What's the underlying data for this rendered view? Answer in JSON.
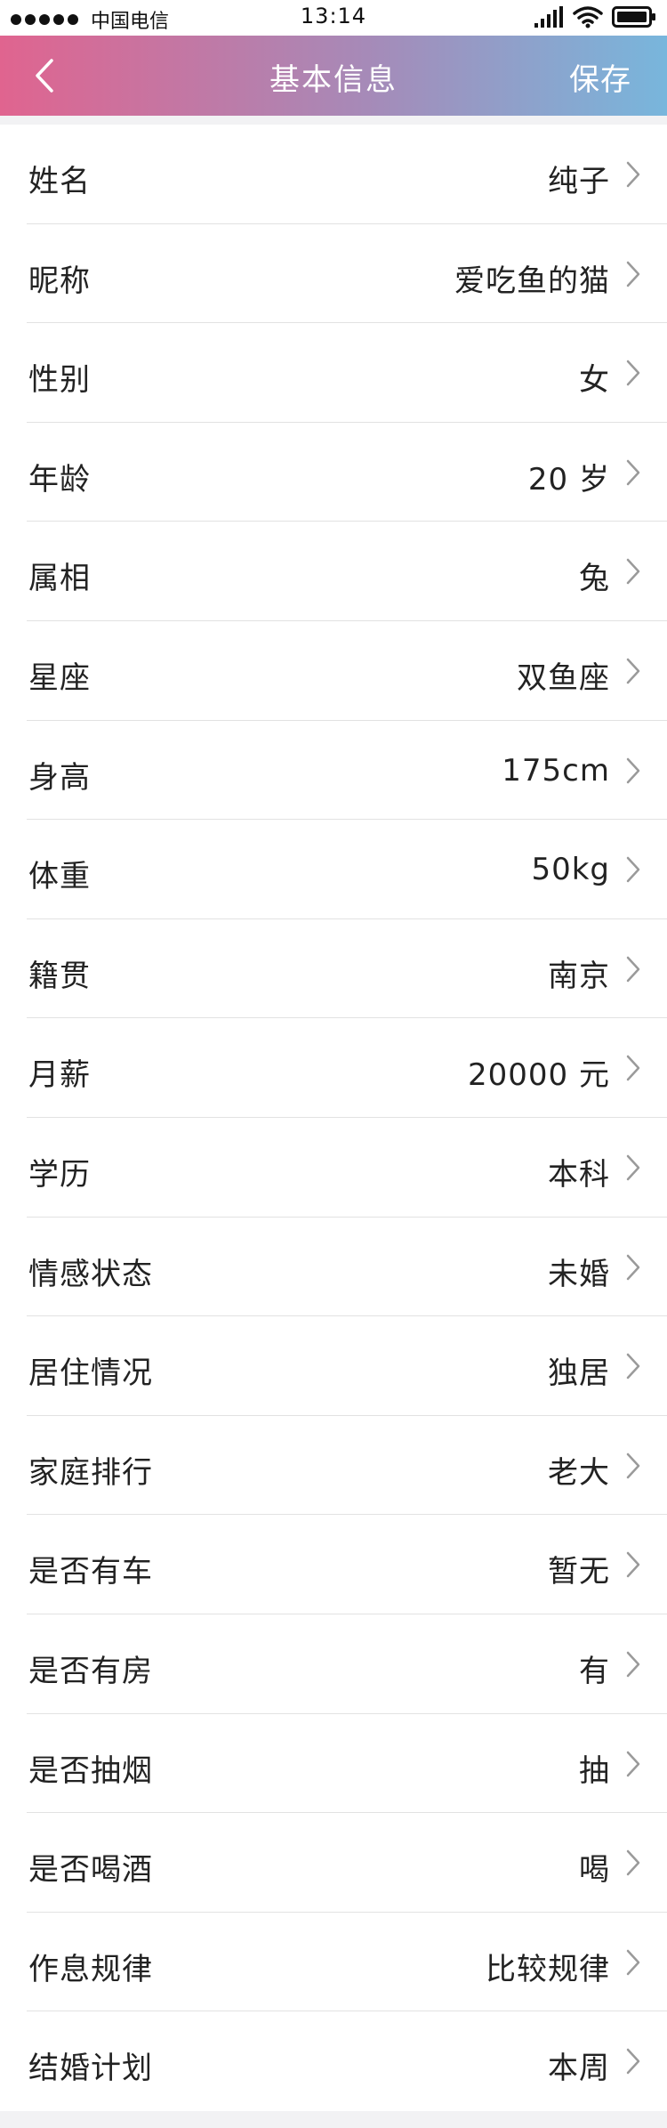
{
  "status_bar": {
    "carrier": "中国电信",
    "time": "13:14"
  },
  "nav": {
    "title": "基本信息",
    "save_label": "保存"
  },
  "fields": [
    {
      "label": "姓名",
      "value": "纯子"
    },
    {
      "label": "昵称",
      "value": "爱吃鱼的猫"
    },
    {
      "label": "性别",
      "value": "女"
    },
    {
      "label": "年龄",
      "value": "20 岁"
    },
    {
      "label": "属相",
      "value": "兔"
    },
    {
      "label": "星座",
      "value": "双鱼座"
    },
    {
      "label": "身高",
      "value": "175cm"
    },
    {
      "label": "体重",
      "value": "50kg"
    },
    {
      "label": "籍贯",
      "value": "南京"
    },
    {
      "label": "月薪",
      "value": "20000 元"
    },
    {
      "label": "学历",
      "value": "本科"
    },
    {
      "label": "情感状态",
      "value": "未婚"
    },
    {
      "label": "居住情况",
      "value": "独居"
    },
    {
      "label": "家庭排行",
      "value": "老大"
    },
    {
      "label": "是否有车",
      "value": "暂无"
    },
    {
      "label": "是否有房",
      "value": "有"
    },
    {
      "label": "是否抽烟",
      "value": "抽"
    },
    {
      "label": "是否喝酒",
      "value": "喝"
    },
    {
      "label": "作息规律",
      "value": "比较规律"
    },
    {
      "label": "结婚计划",
      "value": "本周"
    }
  ],
  "icons": {
    "back": "chevron-left-icon",
    "row": "chevron-right-icon"
  },
  "colors": {
    "gradient_start": "#e0648f",
    "gradient_end": "#78b6dc"
  }
}
